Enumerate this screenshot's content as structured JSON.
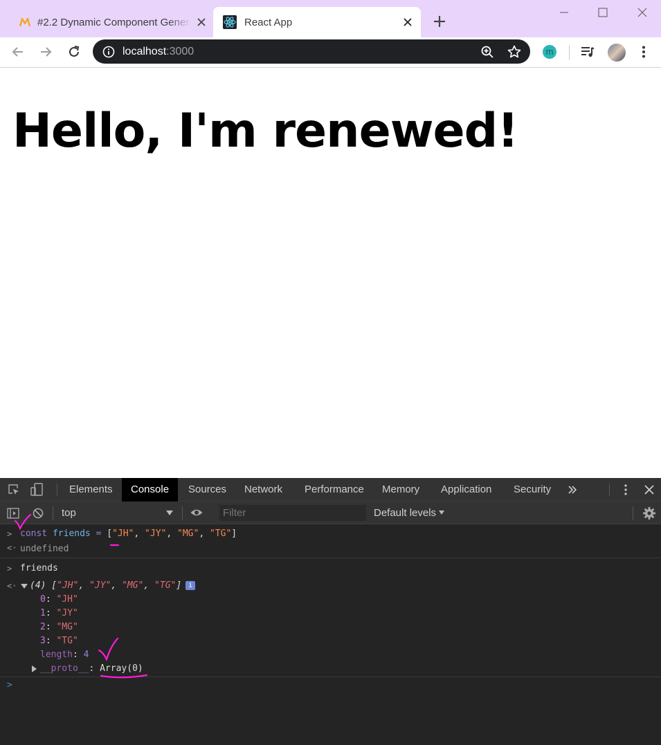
{
  "browser": {
    "tabs": [
      {
        "title": "#2.2 Dynamic Component Generation",
        "icon": "nomad-coders-icon"
      },
      {
        "title": "React App",
        "icon": "react-icon"
      }
    ],
    "url_host": "localhost",
    "url_port": ":3000",
    "extension_letter": "m"
  },
  "page": {
    "heading": "Hello, I'm renewed!"
  },
  "devtools": {
    "tabs": [
      "Elements",
      "Console",
      "Sources",
      "Network",
      "Performance",
      "Memory",
      "Application",
      "Security"
    ],
    "active_tab": "Console",
    "context": "top",
    "filter_placeholder": "Filter",
    "levels": "Default levels",
    "console": {
      "cmd1": {
        "kw": "const",
        "name": "friends",
        "eq": "=",
        "open": "[",
        "items": [
          "\"JH\"",
          "\"JY\"",
          "\"MG\"",
          "\"TG\""
        ],
        "close": "]"
      },
      "result1": "undefined",
      "cmd2": "friends",
      "summary": {
        "count": "(4)",
        "preview": [
          "\"JH\"",
          "\"JY\"",
          "\"MG\"",
          "\"TG\""
        ],
        "info": "i"
      },
      "entries": [
        {
          "key": "0",
          "value": "\"JH\""
        },
        {
          "key": "1",
          "value": "\"JY\""
        },
        {
          "key": "2",
          "value": "\"MG\""
        },
        {
          "key": "3",
          "value": "\"TG\""
        }
      ],
      "length_key": "length",
      "length_value": "4",
      "proto_key": "__proto__",
      "proto_value": "Array(0)"
    }
  },
  "colors": {
    "tab_strip": "#e9d5fb",
    "annotation": "#ff1ad9",
    "devtools_bg": "#242424"
  }
}
